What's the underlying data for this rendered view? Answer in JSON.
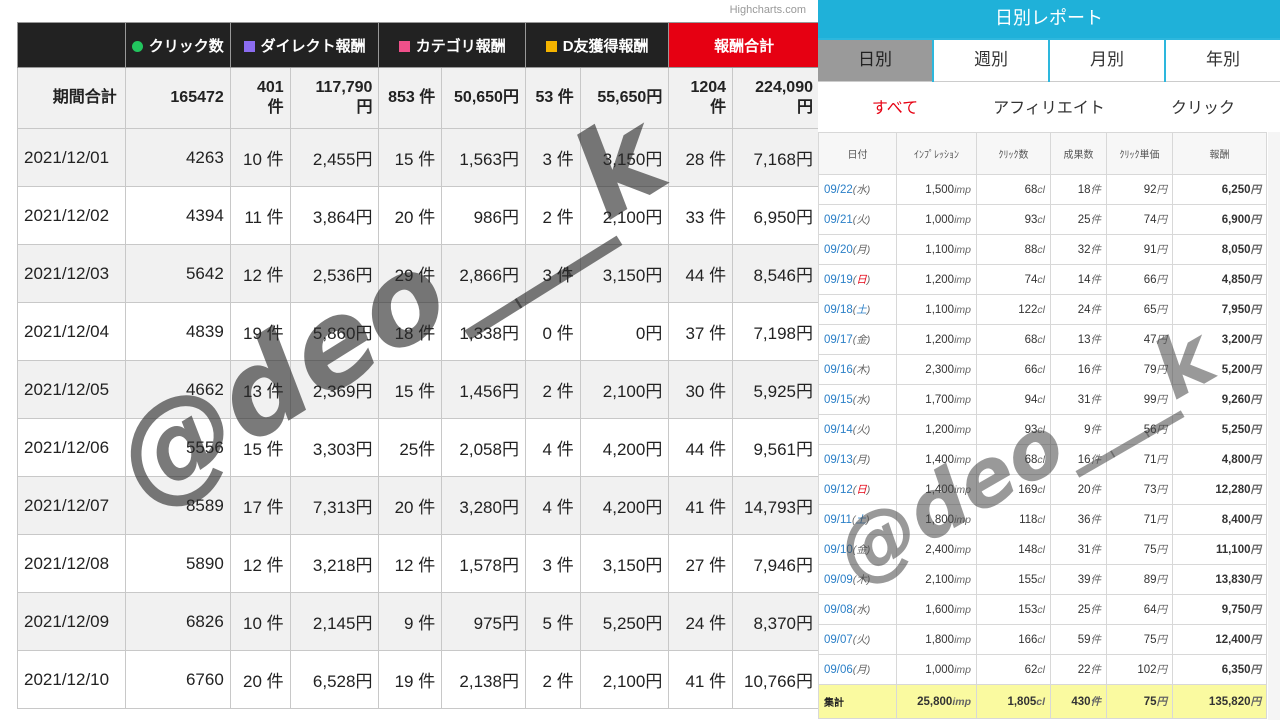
{
  "credit": "Highcharts.com",
  "left_table": {
    "headers": [
      {
        "label": "",
        "color": ""
      },
      {
        "label": "クリック数",
        "color": "#22c55e",
        "shape": "circle"
      },
      {
        "label": "ダイレクト報酬",
        "color": "#8b6cf0",
        "shape": "square"
      },
      {
        "label": "カテゴリ報酬",
        "color": "#f0508a",
        "shape": "square"
      },
      {
        "label": "D友獲得報酬",
        "color": "#f5b400",
        "shape": "square"
      },
      {
        "label": "報酬合計",
        "color": "#e60012",
        "shape": "none"
      }
    ],
    "total": [
      "期間合計",
      "165472",
      "401\n件",
      "117,790\n円",
      "853 件",
      "50,650円",
      "53 件",
      "55,650円",
      "1204\n件",
      "224,090\n円"
    ],
    "rows": [
      [
        "2021/12/01",
        "4263",
        "10 件",
        "2,455円",
        "15 件",
        "1,563円",
        "3 件",
        "3,150円",
        "28 件",
        "7,168円"
      ],
      [
        "2021/12/02",
        "4394",
        "11 件",
        "3,864円",
        "20 件",
        "986円",
        "2 件",
        "2,100円",
        "33 件",
        "6,950円"
      ],
      [
        "2021/12/03",
        "5642",
        "12 件",
        "2,536円",
        "29 件",
        "2,866円",
        "3 件",
        "3,150円",
        "44 件",
        "8,546円"
      ],
      [
        "2021/12/04",
        "4839",
        "19 件",
        "5,860円",
        "18 件",
        "1,338円",
        "0 件",
        "0円",
        "37 件",
        "7,198円"
      ],
      [
        "2021/12/05",
        "4662",
        "13 件",
        "2,369円",
        "15 件",
        "1,456円",
        "2 件",
        "2,100円",
        "30 件",
        "5,925円"
      ],
      [
        "2021/12/06",
        "5556",
        "15 件",
        "3,303円",
        "25件",
        "2,058円",
        "4 件",
        "4,200円",
        "44 件",
        "9,561円"
      ],
      [
        "2021/12/07",
        "8589",
        "17 件",
        "7,313円",
        "20 件",
        "3,280円",
        "4 件",
        "4,200円",
        "41 件",
        "14,793円"
      ],
      [
        "2021/12/08",
        "5890",
        "12 件",
        "3,218円",
        "12 件",
        "1,578円",
        "3 件",
        "3,150円",
        "27 件",
        "7,946円"
      ],
      [
        "2021/12/09",
        "6826",
        "10 件",
        "2,145円",
        "9 件",
        "975円",
        "5 件",
        "5,250円",
        "24 件",
        "8,370円"
      ],
      [
        "2021/12/10",
        "6760",
        "20 件",
        "6,528円",
        "19 件",
        "2,138円",
        "2 件",
        "2,100円",
        "41 件",
        "10,766円"
      ]
    ]
  },
  "right_panel": {
    "title": "日別レポート",
    "tabs": [
      "日別",
      "週別",
      "月別",
      "年別"
    ],
    "active_tab": 0,
    "filters": [
      "すべて",
      "アフィリエイト",
      "クリック"
    ],
    "active_filter": 0,
    "columns": [
      "日付",
      "ｲﾝﾌﾟﾚｯｼｮﾝ",
      "ｸﾘｯｸ数",
      "成果数",
      "ｸﾘｯｸ単価",
      "報酬"
    ],
    "rows": [
      {
        "date": "09/22",
        "dow": "水",
        "dow_type": "weekday",
        "imp": "1,500",
        "clicks": "68",
        "results": "18",
        "cpc": "92",
        "reward": "6,250"
      },
      {
        "date": "09/21",
        "dow": "火",
        "dow_type": "weekday",
        "imp": "1,000",
        "clicks": "93",
        "results": "25",
        "cpc": "74",
        "reward": "6,900"
      },
      {
        "date": "09/20",
        "dow": "月",
        "dow_type": "weekday",
        "imp": "1,100",
        "clicks": "88",
        "results": "32",
        "cpc": "91",
        "reward": "8,050"
      },
      {
        "date": "09/19",
        "dow": "日",
        "dow_type": "sun",
        "imp": "1,200",
        "clicks": "74",
        "results": "14",
        "cpc": "66",
        "reward": "4,850"
      },
      {
        "date": "09/18",
        "dow": "土",
        "dow_type": "sat",
        "imp": "1,100",
        "clicks": "122",
        "results": "24",
        "cpc": "65",
        "reward": "7,950"
      },
      {
        "date": "09/17",
        "dow": "金",
        "dow_type": "weekday",
        "imp": "1,200",
        "clicks": "68",
        "results": "13",
        "cpc": "47",
        "reward": "3,200"
      },
      {
        "date": "09/16",
        "dow": "木",
        "dow_type": "weekday",
        "imp": "2,300",
        "clicks": "66",
        "results": "16",
        "cpc": "79",
        "reward": "5,200"
      },
      {
        "date": "09/15",
        "dow": "水",
        "dow_type": "weekday",
        "imp": "1,700",
        "clicks": "94",
        "results": "31",
        "cpc": "99",
        "reward": "9,260"
      },
      {
        "date": "09/14",
        "dow": "火",
        "dow_type": "weekday",
        "imp": "1,200",
        "clicks": "93",
        "results": "9",
        "cpc": "56",
        "reward": "5,250"
      },
      {
        "date": "09/13",
        "dow": "月",
        "dow_type": "weekday",
        "imp": "1,400",
        "clicks": "68",
        "results": "16",
        "cpc": "71",
        "reward": "4,800"
      },
      {
        "date": "09/12",
        "dow": "日",
        "dow_type": "sun",
        "imp": "1,400",
        "clicks": "169",
        "results": "20",
        "cpc": "73",
        "reward": "12,280"
      },
      {
        "date": "09/11",
        "dow": "土",
        "dow_type": "sat",
        "imp": "1,800",
        "clicks": "118",
        "results": "36",
        "cpc": "71",
        "reward": "8,400"
      },
      {
        "date": "09/10",
        "dow": "金",
        "dow_type": "weekday",
        "imp": "2,400",
        "clicks": "148",
        "results": "31",
        "cpc": "75",
        "reward": "11,100"
      },
      {
        "date": "09/09",
        "dow": "木",
        "dow_type": "weekday",
        "imp": "2,100",
        "clicks": "155",
        "results": "39",
        "cpc": "89",
        "reward": "13,830"
      },
      {
        "date": "09/08",
        "dow": "水",
        "dow_type": "weekday",
        "imp": "1,600",
        "clicks": "153",
        "results": "25",
        "cpc": "64",
        "reward": "9,750"
      },
      {
        "date": "09/07",
        "dow": "火",
        "dow_type": "weekday",
        "imp": "1,800",
        "clicks": "166",
        "results": "59",
        "cpc": "75",
        "reward": "12,400"
      },
      {
        "date": "09/06",
        "dow": "月",
        "dow_type": "weekday",
        "imp": "1,000",
        "clicks": "62",
        "results": "22",
        "cpc": "102",
        "reward": "6,350"
      }
    ],
    "units": {
      "imp": "imp",
      "clicks": "cl",
      "results": "件",
      "yen": "円"
    },
    "summary": {
      "label": "集計",
      "imp": "25,800",
      "clicks": "1,805",
      "results": "430",
      "cpc": "75",
      "reward": "135,820"
    }
  },
  "watermarks": [
    "@deo___k",
    "@deo___k"
  ]
}
